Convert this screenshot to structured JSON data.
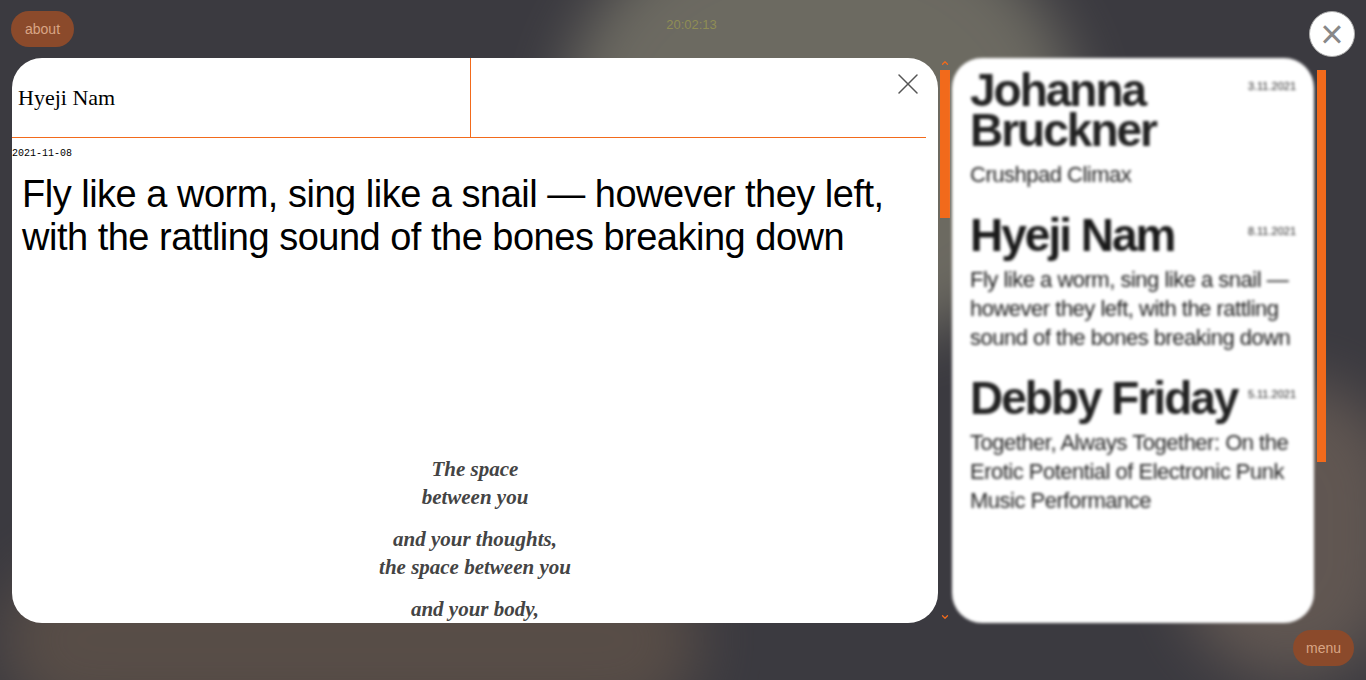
{
  "top_bar": {
    "about_button": "about",
    "time": "20:02:13",
    "close_button": "×"
  },
  "article": {
    "author": "Hyeji Nam",
    "date": "2021-11-08",
    "title": "Fly like a worm, sing like a snail — however they left, with the rattling sound of the bones breaking down",
    "poem": [
      [
        "The space",
        "between you"
      ],
      [
        "and your thoughts,",
        "the space between you"
      ],
      [
        "and your body,"
      ]
    ]
  },
  "list": {
    "items": [
      {
        "name": "Johanna Bruckner",
        "date": "3.11.2021",
        "subtitle": "Crushpad Climax",
        "selected": false
      },
      {
        "name": "Hyeji Nam",
        "date": "8.11.2021",
        "subtitle": "Fly like a worm, sing like a snail — however they left, with the rattling sound of the bones breaking down",
        "selected": true
      },
      {
        "name": "Debby Friday",
        "date": "5.11.2021",
        "subtitle": "Together, Always Together: On the Erotic Potential of Electronic Punk Music Performance",
        "selected": false
      }
    ]
  },
  "bottom_bar": {
    "menu_button": "menu"
  }
}
